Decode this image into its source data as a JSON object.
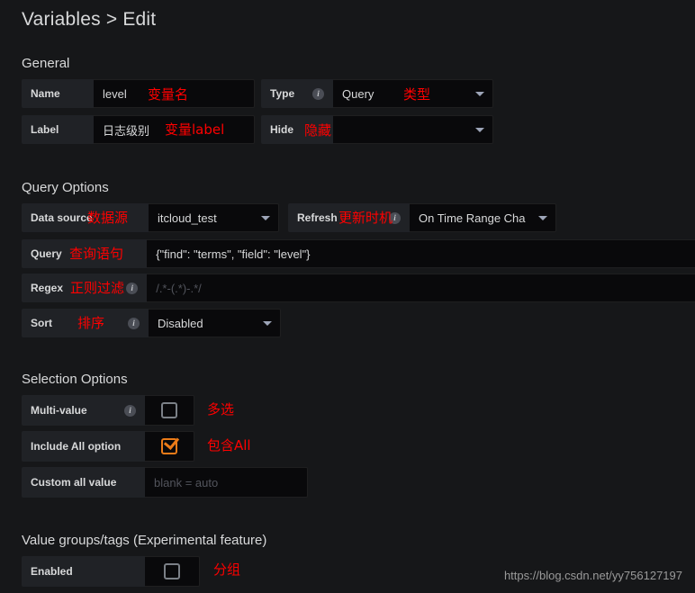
{
  "page": {
    "title": "Variables > Edit",
    "watermark": "https://blog.csdn.net/yy756127197"
  },
  "sections": {
    "general": {
      "heading": "General",
      "name": {
        "label": "Name",
        "value": "level",
        "annotation": "变量名"
      },
      "label_row": {
        "label": "Label",
        "value": "日志级别",
        "annotation": "变量label"
      },
      "type": {
        "label": "Type",
        "value": "Query",
        "annotation": "类型",
        "info_icon": "info-icon"
      },
      "hide": {
        "label": "Hide",
        "value": "",
        "annotation": "隐藏"
      }
    },
    "query_options": {
      "heading": "Query Options",
      "data_source": {
        "label": "Data source",
        "value": "itcloud_test",
        "annotation": "数据源"
      },
      "refresh": {
        "label": "Refresh",
        "value": "On Time Range Cha",
        "annotation": "更新时机",
        "info_icon": "info-icon"
      },
      "query": {
        "label": "Query",
        "value": "{\"find\": \"terms\", \"field\": \"level\"}",
        "annotation": "查询语句"
      },
      "regex": {
        "label": "Regex",
        "placeholder": "/.*-(.*)-.*/",
        "value": "",
        "annotation": "正则过滤",
        "info_icon": "info-icon"
      },
      "sort": {
        "label": "Sort",
        "value": "Disabled",
        "annotation": "排序",
        "info_icon": "info-icon"
      }
    },
    "selection_options": {
      "heading": "Selection Options",
      "multi_value": {
        "label": "Multi-value",
        "checked": false,
        "annotation": "多选",
        "info_icon": "info-icon"
      },
      "include_all": {
        "label": "Include All option",
        "checked": true,
        "annotation": "包含All"
      },
      "custom_all": {
        "label": "Custom all value",
        "placeholder": "blank = auto",
        "value": ""
      }
    },
    "value_groups": {
      "heading": "Value groups/tags (Experimental feature)",
      "enabled": {
        "label": "Enabled",
        "checked": false,
        "annotation": "分组"
      }
    }
  },
  "colors": {
    "background": "#161719",
    "label_cell": "#202226",
    "input_bg": "#09090b",
    "accent": "#eb7b18",
    "annotation": "#ff0000",
    "text": "#d8d9da"
  }
}
